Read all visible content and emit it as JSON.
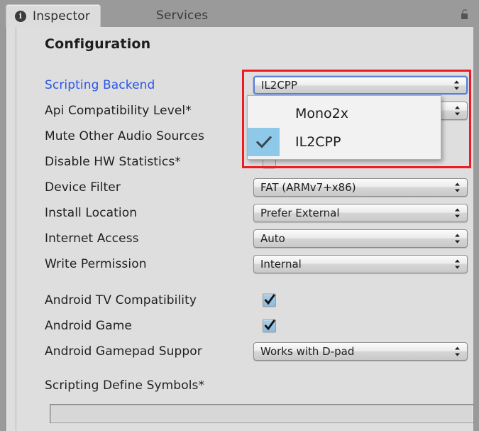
{
  "window": {
    "tabs": [
      {
        "label": "Inspector",
        "icon": "info-icon",
        "active": true
      },
      {
        "label": "Services",
        "icon": "",
        "active": false
      }
    ],
    "lock_icon": "padlock-open-icon"
  },
  "inspector": {
    "section_title": "Configuration",
    "rows": [
      {
        "label": "Scripting Backend",
        "accent": true,
        "control": "popup",
        "value": "IL2CPP",
        "focused": true
      },
      {
        "label": "Api Compatibility Level*",
        "accent": false,
        "control": "popup",
        "value": "",
        "focused": false
      },
      {
        "label": "Mute Other Audio Sources",
        "accent": false,
        "control": "checkbox",
        "value": "",
        "checked": false
      },
      {
        "label": "Disable HW Statistics*",
        "accent": false,
        "control": "checkbox",
        "value": "",
        "checked": false
      },
      {
        "label": "Device Filter",
        "accent": false,
        "control": "popup",
        "value": "FAT (ARMv7+x86)",
        "focused": false
      },
      {
        "label": "Install Location",
        "accent": false,
        "control": "popup",
        "value": "Prefer External",
        "focused": false
      },
      {
        "label": "Internet Access",
        "accent": false,
        "control": "popup",
        "value": "Auto",
        "focused": false
      },
      {
        "label": "Write Permission",
        "accent": false,
        "control": "popup",
        "value": "Internal",
        "focused": false
      },
      {
        "label": "Android TV Compatibility",
        "accent": false,
        "control": "checkbox",
        "value": "",
        "checked": true
      },
      {
        "label": "Android Game",
        "accent": false,
        "control": "checkbox",
        "value": "",
        "checked": true
      },
      {
        "label": "Android Gamepad Suppor",
        "accent": false,
        "control": "popup",
        "value": "Works with D-pad",
        "focused": false
      }
    ],
    "define_symbols": {
      "label": "Scripting Define Symbols*",
      "value": "",
      "placeholder": ""
    }
  },
  "dropdown_menu": {
    "open": true,
    "items": [
      {
        "label": "Mono2x",
        "checked": false
      },
      {
        "label": "IL2CPP",
        "checked": true
      }
    ]
  },
  "colors": {
    "accent_label": "#2a56e8",
    "highlight": "#8fc9ea",
    "annotation": "#ee1b24",
    "panel_bg": "#dedede",
    "window_bg": "#9a9a9a"
  }
}
